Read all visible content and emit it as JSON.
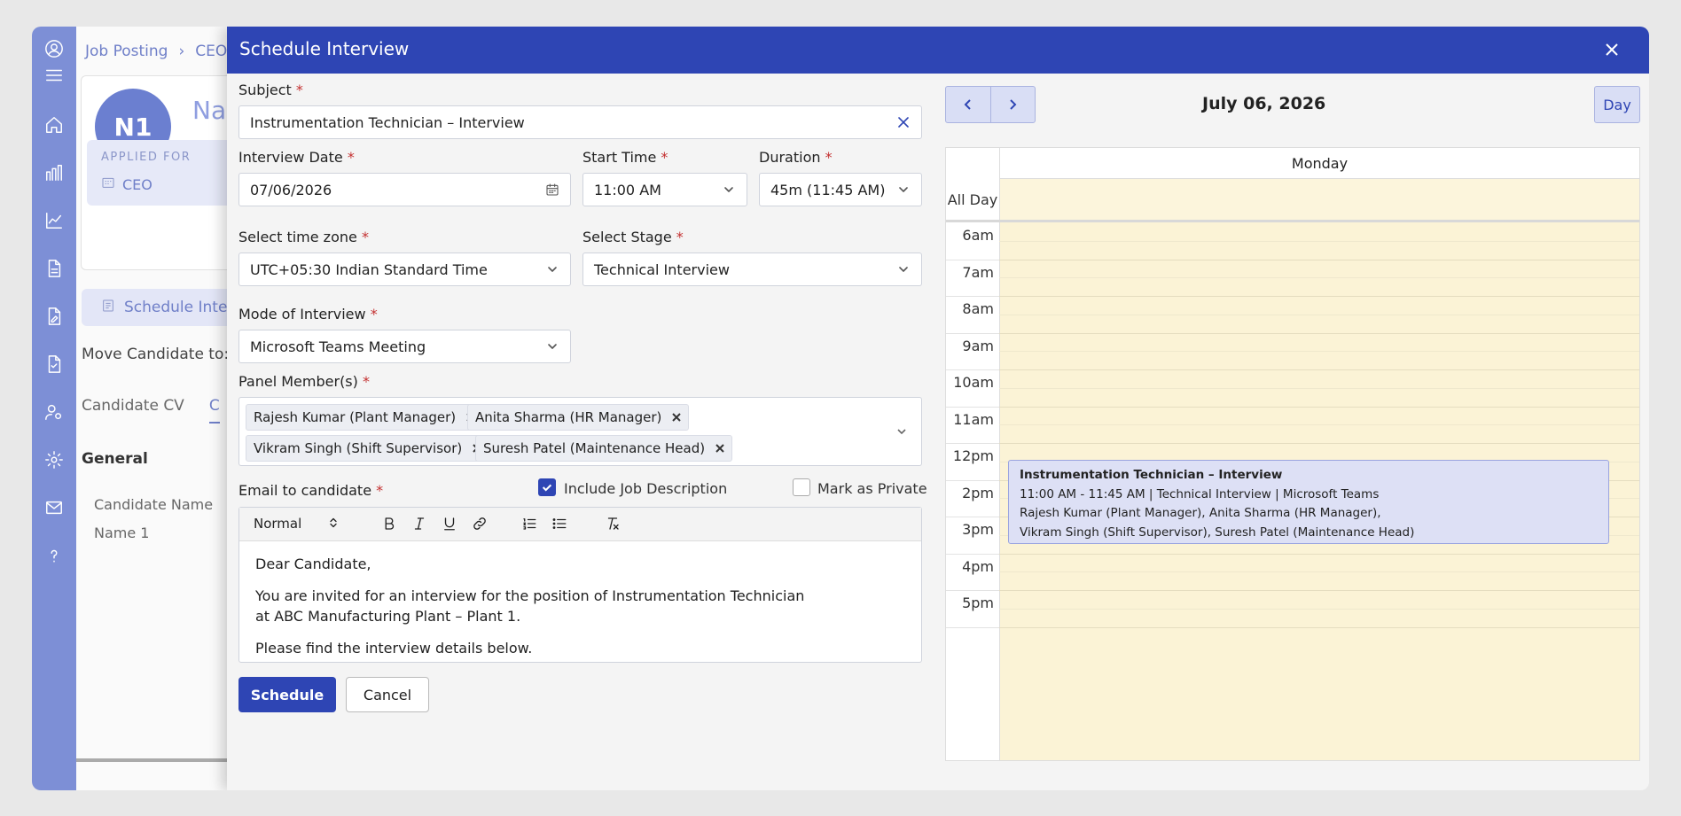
{
  "background_page": {
    "breadcrumb": [
      "Job Posting",
      "CEO"
    ],
    "candidate_initials": "N1",
    "candidate_name_partial": "Na",
    "applied_for_label": "APPLIED FOR",
    "applied_for_value": "CEO",
    "schedule_button": "Schedule Inter",
    "move_candidate_label": "Move Candidate to:",
    "tabs": [
      "Candidate CV",
      "C"
    ],
    "section_title": "General",
    "field_label": "Candidate Name",
    "field_value": "Name 1"
  },
  "modal": {
    "title": "Schedule Interview",
    "subject": {
      "label": "Subject",
      "value": "Instrumentation Technician – Interview"
    },
    "interview_date": {
      "label": "Interview Date",
      "value": "07/06/2026"
    },
    "start_time": {
      "label": "Start Time",
      "value": "11:00 AM"
    },
    "duration": {
      "label": "Duration",
      "value": "45m (11:45 AM)"
    },
    "time_zone": {
      "label": "Select time zone",
      "value": "UTC+05:30 Indian Standard Time"
    },
    "stage": {
      "label": "Select Stage",
      "value": "Technical Interview"
    },
    "mode": {
      "label": "Mode of Interview",
      "value": "Microsoft Teams Meeting"
    },
    "panel": {
      "label": "Panel Member(s)",
      "members": [
        "Rajesh Kumar (Plant Manager)",
        "Anita Sharma (HR Manager)",
        "Vikram Singh (Shift Supervisor)",
        "Suresh Patel (Maintenance Head)"
      ]
    },
    "email": {
      "label": "Email to candidate",
      "include_jd_label": "Include Job Description",
      "include_jd_checked": true,
      "private_label": "Mark as Private",
      "private_checked": false,
      "format": "Normal",
      "body": [
        "Dear Candidate,",
        "You are invited for an interview for the position of Instrumentation Technician",
        "at ABC Manufacturing Plant – Plant 1.",
        "Please find the interview details below."
      ]
    },
    "schedule_label": "Schedule",
    "cancel_label": "Cancel",
    "required_mark": "*"
  },
  "calendar": {
    "date": "July 06, 2026",
    "view": "Day",
    "weekday": "Monday",
    "all_day_label": "All Day",
    "hours": [
      "6am",
      "7am",
      "8am",
      "9am",
      "10am",
      "11am",
      "12pm",
      "2pm",
      "3pm",
      "4pm",
      "5pm"
    ],
    "event": {
      "title": "Instrumentation Technician – Interview",
      "line1": "11:00 AM - 11:45 AM  |  Technical Interview  |  Microsoft Teams",
      "line2": "Rajesh Kumar (Plant Manager), Anita Sharma (HR Manager),",
      "line3": "Vikram Singh (Shift Supervisor), Suresh Patel (Maintenance Head)"
    }
  },
  "colors": {
    "primary": "#2e45b4",
    "sidebar": "#7d8fd6",
    "calendar_bg": "#fbf3d6",
    "event_bg": "#dde0f5"
  }
}
